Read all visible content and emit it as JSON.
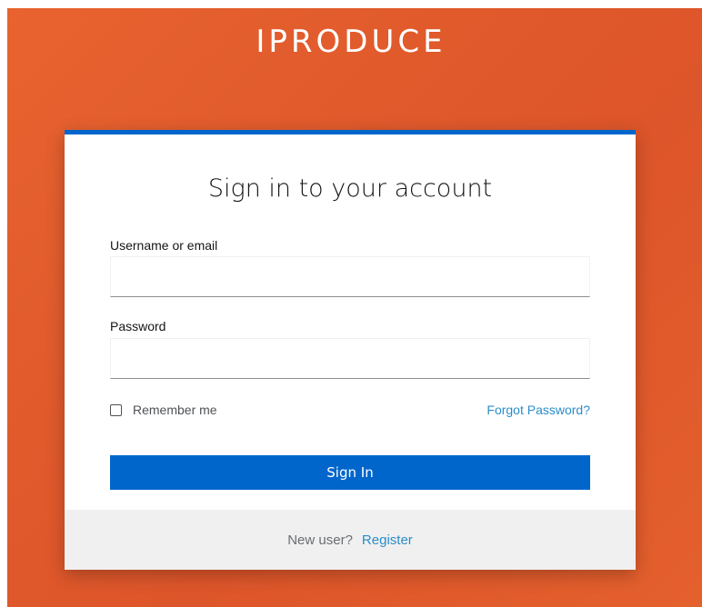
{
  "brand": {
    "title": "IPRODUCE"
  },
  "login": {
    "heading": "Sign in to your account",
    "username_label": "Username or email",
    "username_value": "",
    "password_label": "Password",
    "password_value": "",
    "remember_label": "Remember me",
    "remember_checked": false,
    "forgot_label": "Forgot Password?",
    "submit_label": "Sign In"
  },
  "footer": {
    "prompt": "New user?",
    "register_label": "Register"
  },
  "colors": {
    "background": "#e05a2c",
    "accent": "#0066cc",
    "link": "#2b8dc9",
    "footer_bg": "#f0f0f0"
  }
}
